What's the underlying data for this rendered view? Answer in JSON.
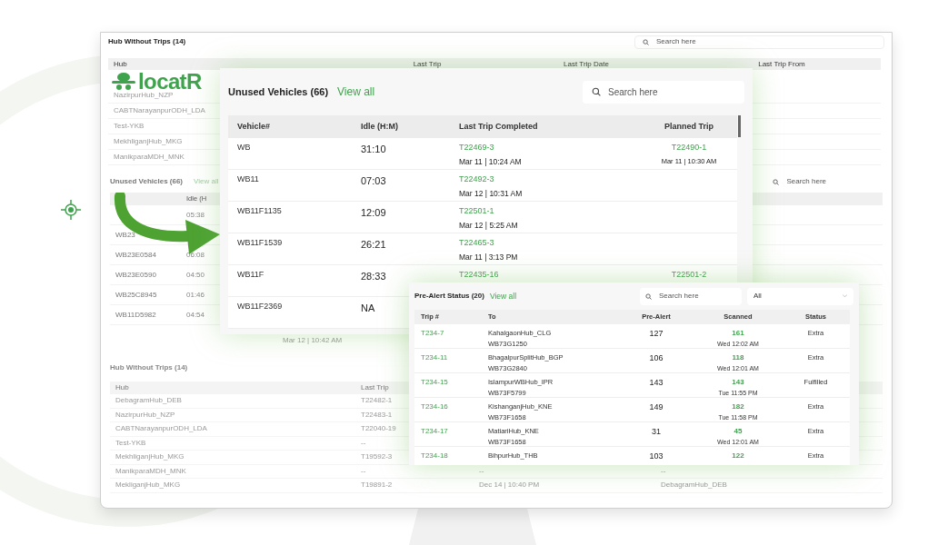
{
  "logo": {
    "text": "locatR"
  },
  "background_dashboard": {
    "hub_overview": {
      "title": "Hub Without Trips (14)",
      "search": {
        "placeholder": "Search here"
      },
      "columns": [
        "Hub",
        "Last Trip",
        "Last Trip Date",
        "Last Trip From"
      ],
      "rows": [
        "NazirpurHub_NZP",
        "CABTNarayanpurODH_LDA",
        "Test-YKB",
        "MekhliganjHub_MKG",
        "ManikparaMDH_MNK"
      ]
    },
    "unused_vehicles": {
      "title": "Unused Vehicles (66)",
      "link": "View all",
      "idle_column": "Idle (H",
      "search": {
        "placeholder": "Search here"
      },
      "note": "Mar 12 | 10:42 AM",
      "rows": [
        {
          "idle": "05:38"
        },
        {
          "vehicle": "WB23"
        },
        {
          "vehicle": "WB23E0584",
          "idle": "06:08"
        },
        {
          "vehicle": "WB23E0590",
          "idle": "04:50"
        },
        {
          "vehicle": "WB25C8945",
          "idle": "01:46"
        },
        {
          "vehicle": "WB11D5982",
          "idle": "04:54"
        }
      ]
    },
    "hub_table": {
      "title": "Hub Without Trips (14)",
      "columns": [
        "Hub",
        "Last Trip"
      ],
      "rows": [
        {
          "hub": "DebagramHub_DEB",
          "last_trip": "T22482-1"
        },
        {
          "hub": "NazirpurHub_NZP",
          "last_trip": "T22483-1"
        },
        {
          "hub": "CABTNarayanpurODH_LDA",
          "last_trip": "T22040-19"
        },
        {
          "hub": "Test-YKB",
          "last_trip": "--"
        },
        {
          "hub": "MekhliganjHub_MKG",
          "last_trip": "T19592-3"
        },
        {
          "hub": "ManikparaMDH_MNK",
          "last_trip": "--",
          "last_trip_date": "--",
          "last_trip_from": "--"
        },
        {
          "hub": "MekliganjHub_MKG",
          "last_trip": "T19891-2",
          "last_trip_date": "Dec 14 | 10:40 PM",
          "last_trip_from": "DebagramHub_DEB"
        }
      ]
    }
  },
  "unused_vehicles_card": {
    "title": "Unused Vehicles (66)",
    "link": "View all",
    "search": {
      "placeholder": "Search here"
    },
    "columns": [
      "Vehicle#",
      "Idle (H:M)",
      "Last Trip Completed",
      "Planned Trip"
    ],
    "rows": [
      {
        "vehicle": "WB",
        "idle": "31:10",
        "last_trip": "T22469-3",
        "last_trip_time": "Mar 11 | 10:24 AM",
        "planned_trip": "T22490-1",
        "planned_time": "Mar 11 | 10:30 AM"
      },
      {
        "vehicle": "WB11",
        "idle": "07:03",
        "last_trip": "T22492-3",
        "last_trip_time": "Mar 12 | 10:31 AM"
      },
      {
        "vehicle": "WB11F1135",
        "idle": "12:09",
        "last_trip": "T22501-1",
        "last_trip_time": "Mar 12 | 5:25 AM"
      },
      {
        "vehicle": "WB11F1539",
        "idle": "26:21",
        "last_trip": "T22465-3",
        "last_trip_time": "Mar 11 | 3:13 PM"
      },
      {
        "vehicle": "WB11F",
        "idle": "28:33",
        "last_trip": "T22435-16",
        "planned_trip": "T22501-2"
      },
      {
        "vehicle": "WB11F2369",
        "idle": "NA"
      }
    ]
  },
  "pre_alert_card": {
    "title": "Pre-Alert Status (20)",
    "link": "View all",
    "search": {
      "placeholder": "Search here"
    },
    "filter": "All",
    "columns": [
      "Trip #",
      "To",
      "Pre-Alert",
      "Scanned",
      "Status"
    ],
    "rows": [
      {
        "trip": "T234-7",
        "to": "KahalgaonHub_CLG",
        "vehicle": "WB73G1250",
        "pre_alert": "127",
        "scanned": "161",
        "scanned_time": "Wed 12:02 AM",
        "status": "Extra"
      },
      {
        "trip": "T234-11",
        "to": "BhagalpurSplitHub_BGP",
        "vehicle": "WB73G2840",
        "pre_alert": "106",
        "scanned": "118",
        "scanned_time": "Wed 12:01 AM",
        "status": "Extra"
      },
      {
        "trip": "T234-15",
        "to": "IslampurWBHub_IPR",
        "vehicle": "WB73F5799",
        "pre_alert": "143",
        "scanned": "143",
        "scanned_time": "Tue 11:55 PM",
        "status": "Fulfilled"
      },
      {
        "trip": "T234-16",
        "to": "KishanganjHub_KNE",
        "vehicle": "WB73F1658",
        "pre_alert": "149",
        "scanned": "182",
        "scanned_time": "Tue 11:58 PM",
        "status": "Extra"
      },
      {
        "trip": "T234-17",
        "to": "MatiariHub_KNE",
        "vehicle": "WB73F1658",
        "pre_alert": "31",
        "scanned": "45",
        "scanned_time": "Wed 12:01 AM",
        "status": "Extra"
      },
      {
        "trip": "T234-18",
        "to": "BihpurHub_THB",
        "pre_alert": "103",
        "scanned": "122",
        "status": "Extra"
      }
    ]
  }
}
